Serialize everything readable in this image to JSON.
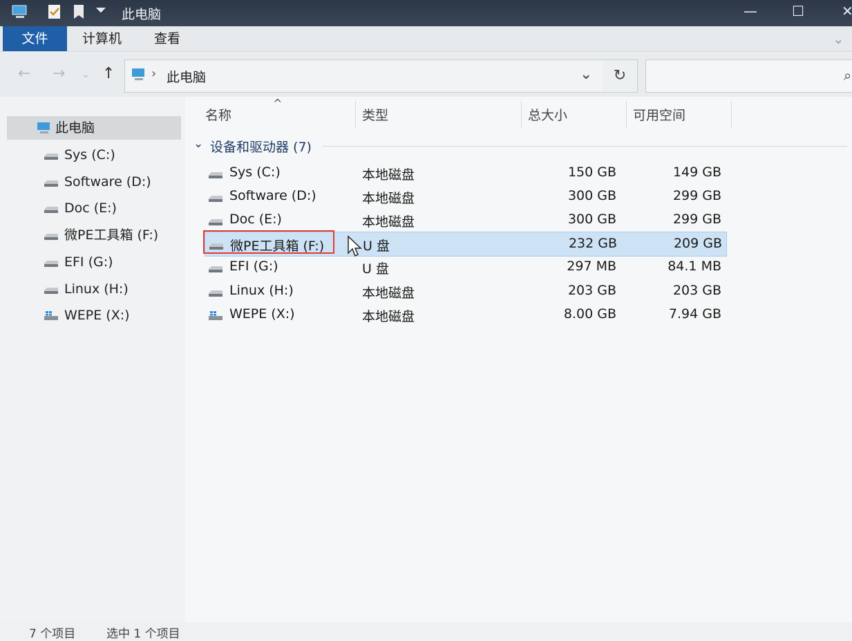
{
  "titlebar": {
    "title": "此电脑"
  },
  "ribbon": {
    "tabs": [
      "文件",
      "计算机",
      "查看"
    ]
  },
  "address": {
    "path": "此电脑"
  },
  "navpane": {
    "root": "此电脑",
    "items": [
      "Sys (C:)",
      "Software (D:)",
      "Doc (E:)",
      "微PE工具箱 (F:)",
      "EFI (G:)",
      "Linux (H:)",
      "WEPE (X:)"
    ]
  },
  "columns": {
    "name": "名称",
    "type": "类型",
    "total": "总大小",
    "free": "可用空间"
  },
  "group": {
    "label": "设备和驱动器 (7)"
  },
  "drives": [
    {
      "name": "Sys (C:)",
      "type": "本地磁盘",
      "total": "150 GB",
      "free": "149 GB",
      "icon": "hard-drive-icon"
    },
    {
      "name": "Software (D:)",
      "type": "本地磁盘",
      "total": "300 GB",
      "free": "299 GB",
      "icon": "hard-drive-icon"
    },
    {
      "name": "Doc (E:)",
      "type": "本地磁盘",
      "total": "300 GB",
      "free": "299 GB",
      "icon": "hard-drive-icon"
    },
    {
      "name": "微PE工具箱 (F:)",
      "type": "U 盘",
      "total": "232 GB",
      "free": "209 GB",
      "icon": "usb-drive-icon",
      "selected": true
    },
    {
      "name": "EFI (G:)",
      "type": "U 盘",
      "total": "297 MB",
      "free": "84.1 MB",
      "icon": "usb-drive-icon"
    },
    {
      "name": "Linux (H:)",
      "type": "本地磁盘",
      "total": "203 GB",
      "free": "203 GB",
      "icon": "hard-drive-icon"
    },
    {
      "name": "WEPE (X:)",
      "type": "本地磁盘",
      "total": "8.00 GB",
      "free": "7.94 GB",
      "icon": "windows-drive-icon"
    }
  ],
  "status": {
    "count": "7 个项目",
    "selected": "选中 1 个项目"
  },
  "colors": {
    "file_tab": "#1f5fa8",
    "selection": "#cde3f5",
    "highlight_box": "#e53935"
  }
}
